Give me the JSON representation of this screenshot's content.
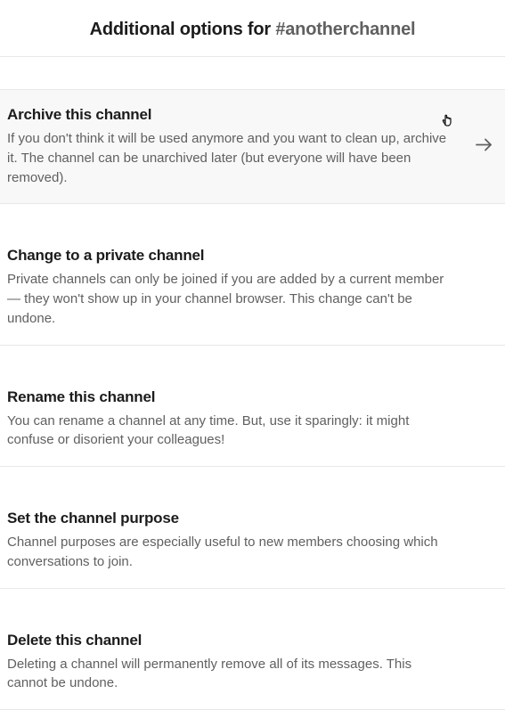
{
  "header": {
    "title_prefix": "Additional options for ",
    "channel_name": "#anotherchannel"
  },
  "options": [
    {
      "title": "Archive this channel",
      "description": "If you don't think it will be used anymore and you want to clean up, archive it. The channel can be unarchived later (but everyone will have been removed).",
      "hovered": true
    },
    {
      "title": "Change to a private channel",
      "description": "Private channels can only be joined if you are added by a current member — they won't show up in your channel browser. This change can't be undone.",
      "hovered": false
    },
    {
      "title": "Rename this channel",
      "description": "You can rename a channel at any time. But, use it sparingly: it might confuse or disorient your colleagues!",
      "hovered": false
    },
    {
      "title": "Set the channel purpose",
      "description": "Channel purposes are especially useful to new members choosing which conversations to join.",
      "hovered": false
    },
    {
      "title": "Delete this channel",
      "description": "Deleting a channel will permanently remove all of its messages. This cannot be undone.",
      "hovered": false
    }
  ]
}
